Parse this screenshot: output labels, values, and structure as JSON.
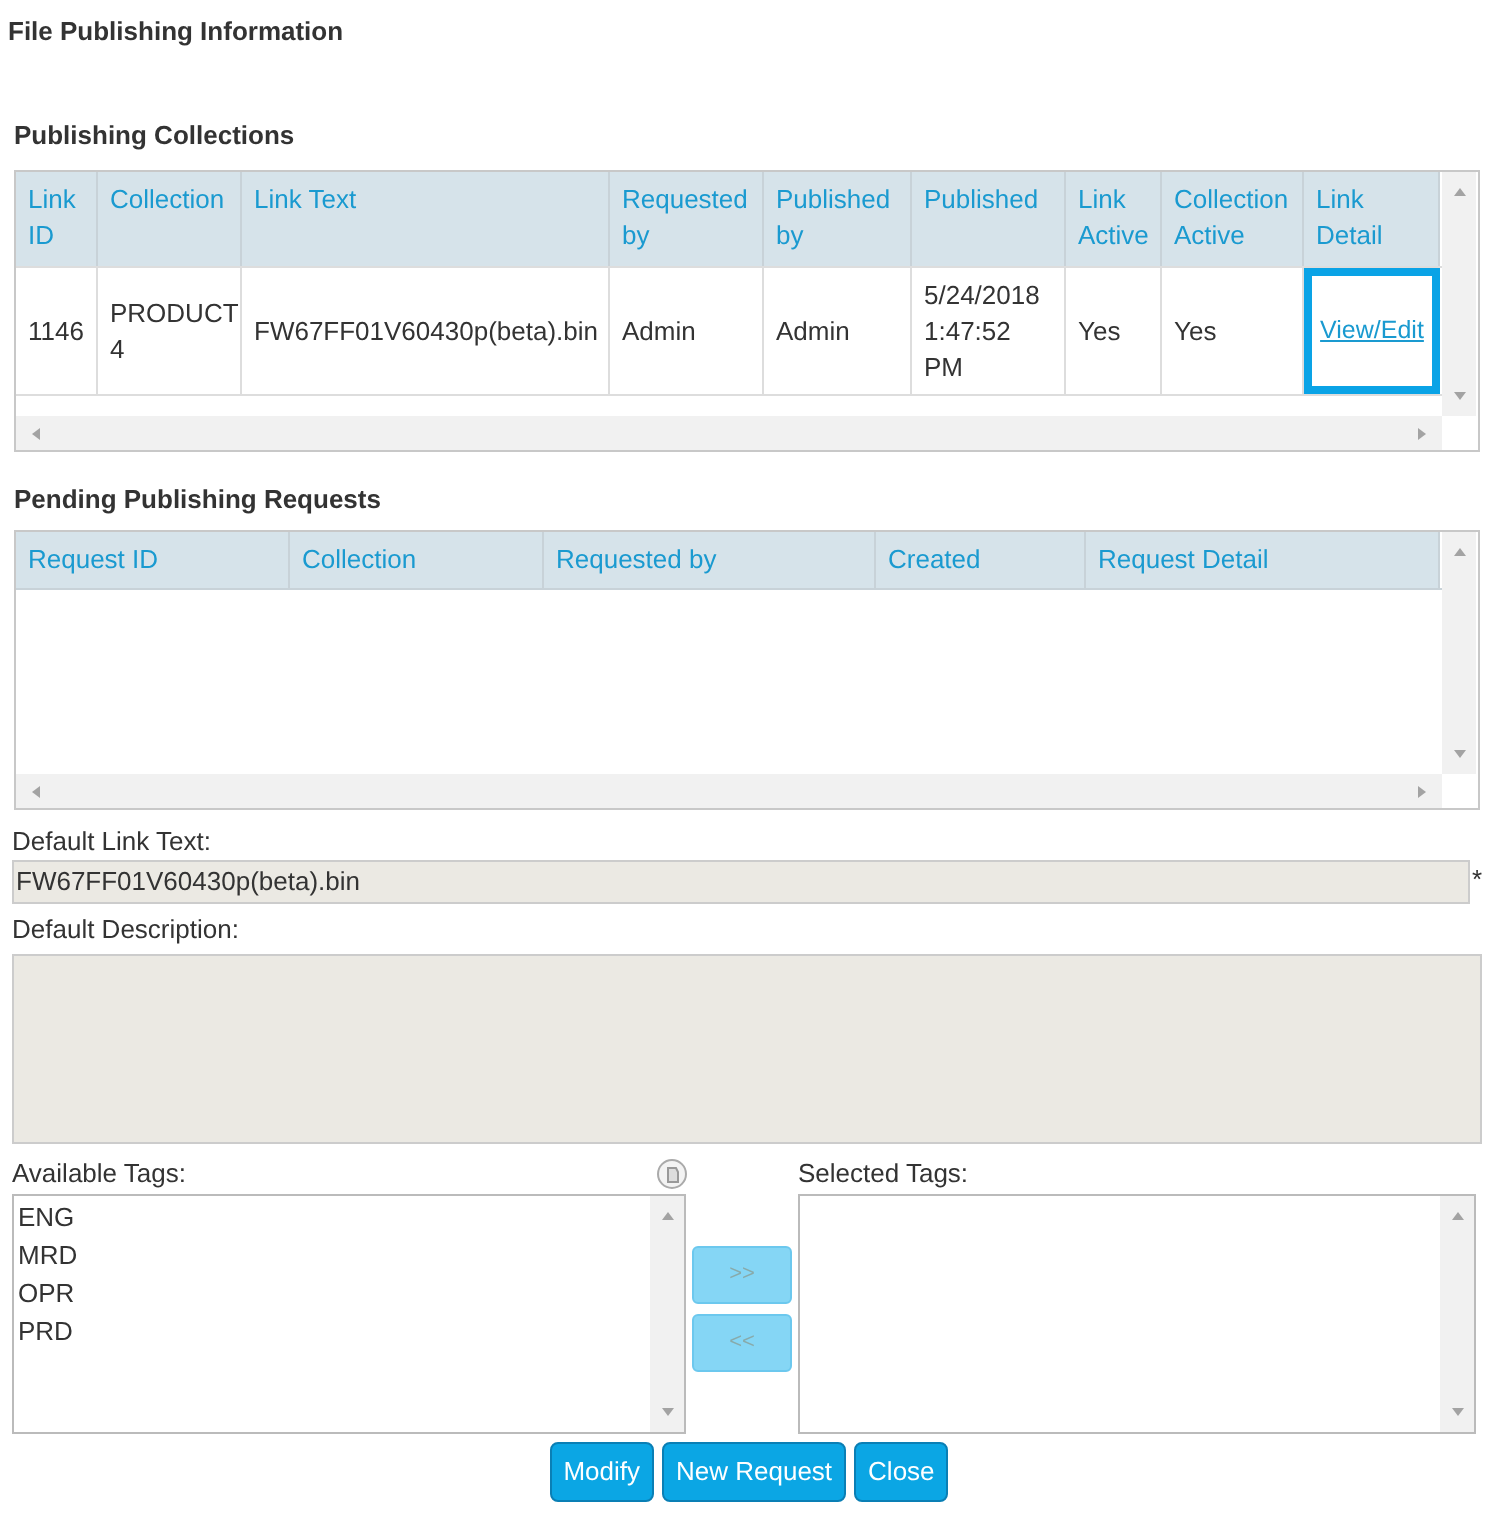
{
  "title": "File Publishing Information",
  "collections": {
    "heading": "Publishing Collections",
    "columns": [
      "Link ID",
      "Collection",
      "Link Text",
      "Requested by",
      "Published by",
      "Published",
      "Link Active",
      "Collection Active",
      "Link Detail"
    ],
    "rows": [
      {
        "cells": [
          "1146",
          "PRODUCT 4",
          "FW67FF01V60430p(beta).bin",
          "Admin",
          "Admin",
          "5/24/2018 1:47:52 PM",
          "Yes",
          "Yes"
        ],
        "link": {
          "label": "View/Edit",
          "focused": true
        }
      }
    ]
  },
  "pending": {
    "heading": "Pending Publishing Requests",
    "columns": [
      "Request ID",
      "Collection",
      "Requested by",
      "Created",
      "Request Detail"
    ]
  },
  "default_link_text": {
    "label": "Default Link Text:",
    "value": "FW67FF01V60430p(beta).bin",
    "required_mark": "*"
  },
  "default_description": {
    "label": "Default Description:"
  },
  "available_tags": {
    "label": "Available Tags:",
    "items": [
      "ENG",
      "MRD",
      "OPR",
      "PRD"
    ]
  },
  "move_buttons": [
    {
      "label": ">>",
      "disabled": true
    },
    {
      "label": "<<",
      "disabled": true
    }
  ],
  "selected_tags": {
    "label": "Selected Tags:"
  },
  "buttons": [
    "Modify",
    "New Request",
    "Close"
  ]
}
